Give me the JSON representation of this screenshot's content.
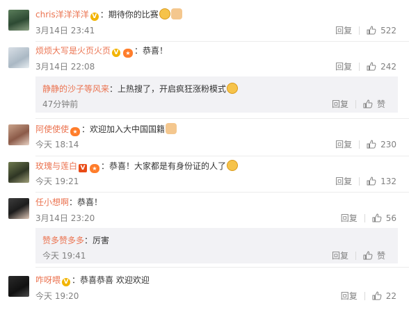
{
  "labels": {
    "reply": "回复",
    "like_zan": "赞"
  },
  "comments": [
    {
      "username": "chris洋洋洋洋",
      "text": "：期待你的比赛",
      "time": "3月14日 23:41",
      "likes": "522",
      "badges": [
        "vip-gold"
      ],
      "emoji": [
        "face-emoji",
        "thumb-emoji"
      ]
    },
    {
      "username": "烦烦大写是火页火页",
      "text": "：恭喜！",
      "time": "3月14日 22:08",
      "likes": "242",
      "badges": [
        "vip-gold",
        "member-star"
      ],
      "reply": {
        "username": "静静的沙子等风来",
        "text": "：上热搜了，开启疯狂涨粉模式",
        "time": "47分钟前",
        "likes": "赞"
      }
    },
    {
      "username": "阿使使使",
      "text": "：欢迎加入大中国国籍",
      "time": "今天 18:14",
      "likes": "230",
      "badges": [
        "member-star"
      ]
    },
    {
      "username": "玫瑰与莲白",
      "text": "：恭喜！大家都是有身份证的人了",
      "time": "今天 19:21",
      "likes": "132",
      "badges": [
        "vip-red",
        "member-star"
      ]
    },
    {
      "username": "任小想啊",
      "text": "：恭喜！",
      "time": "3月14日 23:20",
      "likes": "56",
      "reply": {
        "username": "赞多赞多多",
        "text": "：厉害",
        "time": "今天 19:41",
        "likes": "赞"
      }
    },
    {
      "username": "咋呀喂",
      "text": "：恭喜恭喜 欢迎欢迎",
      "time": "今天 19:20",
      "likes": "22",
      "badges": [
        "vip-gold"
      ]
    }
  ],
  "colors": {
    "username": "#eb7350",
    "meta": "#808080",
    "reply_bg": "#f2f2f5",
    "vip_gold": "#f2b400",
    "vip_red": "#e94b16"
  }
}
